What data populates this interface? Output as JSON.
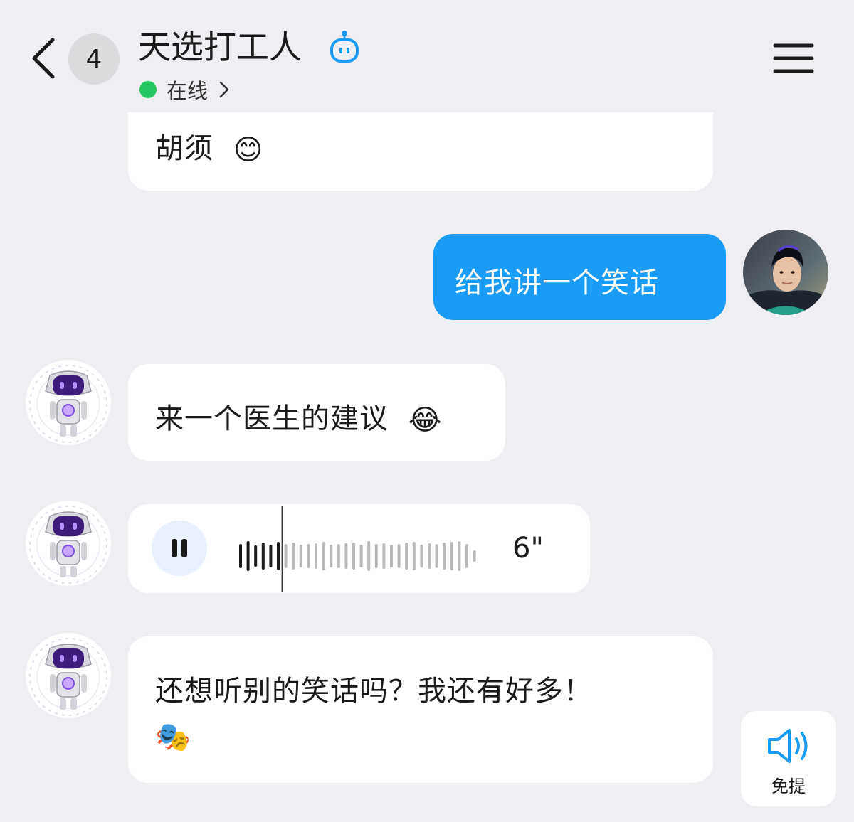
{
  "header": {
    "unread_count": "4",
    "title": "天选打工人",
    "status": "在线",
    "icons": {
      "back": "chevron-left-icon",
      "bot_badge": "robot-icon",
      "status_more": "chevron-right-icon",
      "menu": "hamburger-menu-icon"
    },
    "status_color": "#22c55e"
  },
  "messages": [
    {
      "sender": "bot",
      "type": "text",
      "text": "胡须",
      "emoji": "😊"
    },
    {
      "sender": "user",
      "type": "text",
      "text": "给我讲一个笑话"
    },
    {
      "sender": "bot",
      "type": "text",
      "text": "来一个医生的建议",
      "emoji": "😂"
    },
    {
      "sender": "bot",
      "type": "voice",
      "duration": "6\"",
      "state": "playing",
      "progress": 0.2
    },
    {
      "sender": "bot",
      "type": "text",
      "text": "还想听别的笑话吗？我还有好多！",
      "emoji": "🎭"
    }
  ],
  "mute_button": {
    "label": "免提",
    "icon": "speaker-icon"
  },
  "colors": {
    "background": "#efeff3",
    "user_bubble": "#1a9bf5",
    "bot_bubble": "#ffffff",
    "accent_icon": "#1a9bf5"
  }
}
